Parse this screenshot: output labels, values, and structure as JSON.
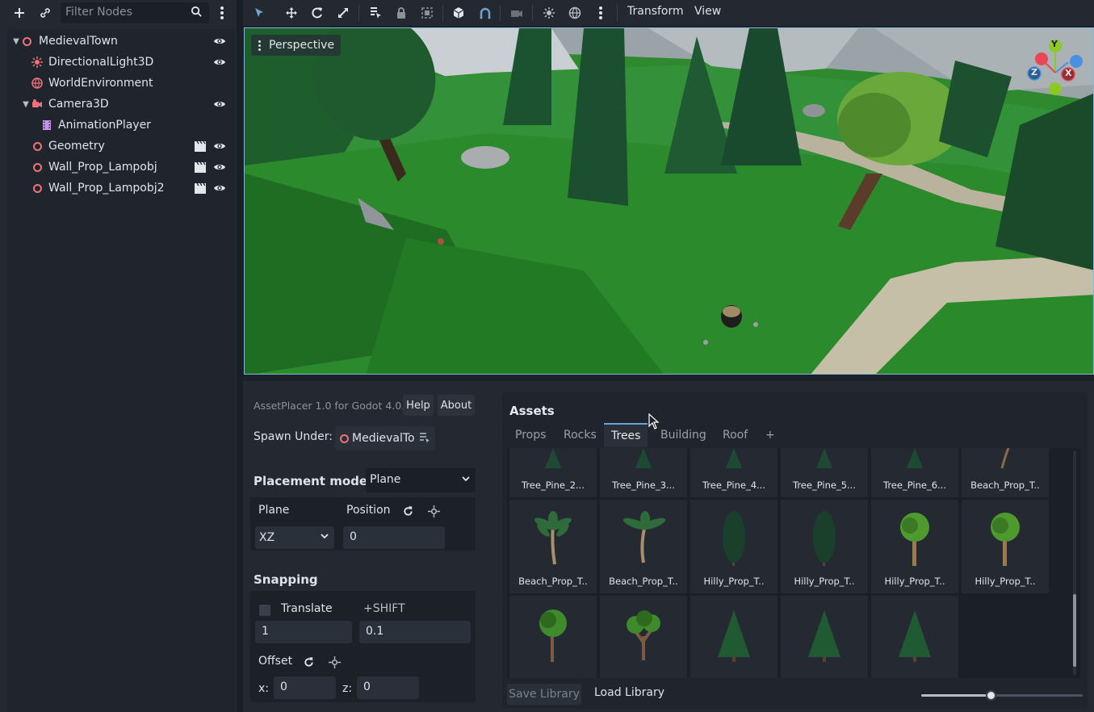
{
  "scene_dock": {
    "filter_placeholder": "Filter Nodes",
    "nodes": [
      {
        "label": "MedievalTown",
        "icon": "node3d-ring-icon",
        "depth": 0,
        "arrow": true,
        "visible": true,
        "scene": false
      },
      {
        "label": "DirectionalLight3D",
        "icon": "sun-light-icon",
        "depth": 1,
        "arrow": false,
        "visible": true,
        "scene": false
      },
      {
        "label": "WorldEnvironment",
        "icon": "globe-icon",
        "depth": 1,
        "arrow": false,
        "visible": false,
        "scene": false
      },
      {
        "label": "Camera3D",
        "icon": "camera-icon",
        "depth": 1,
        "arrow": true,
        "visible": true,
        "scene": false
      },
      {
        "label": "AnimationPlayer",
        "icon": "film-icon",
        "depth": 2,
        "arrow": false,
        "visible": false,
        "scene": false
      },
      {
        "label": "Geometry",
        "icon": "node3d-ring-icon",
        "depth": 1,
        "arrow": false,
        "visible": true,
        "scene": true
      },
      {
        "label": "Wall_Prop_Lampobj",
        "icon": "node3d-ring-icon",
        "depth": 1,
        "arrow": false,
        "visible": true,
        "scene": true
      },
      {
        "label": "Wall_Prop_Lampobj2",
        "icon": "node3d-ring-icon",
        "depth": 1,
        "arrow": false,
        "visible": true,
        "scene": true
      }
    ]
  },
  "toolbar": {
    "transform_label": "Transform",
    "view_label": "View"
  },
  "viewport": {
    "perspective_label": "Perspective",
    "gizmo": {
      "y": "Y",
      "z": "Z",
      "x": "X"
    }
  },
  "asset_placer": {
    "title": "AssetPlacer 1.0 for Godot 4.0.",
    "help_label": "Help",
    "about_label": "About",
    "spawn_under_label": "Spawn Under:",
    "spawn_under_value": "MedievalTo",
    "placement_mode_label": "Placement mode:",
    "placement_mode_value": "Plane",
    "plane_label": "Plane",
    "position_label": "Position",
    "plane_value": "XZ",
    "position_value": "0",
    "snapping_label": "Snapping",
    "translate_label": "Translate",
    "shift_label": "+SHIFT",
    "snap_value": "1",
    "snap_shift_value": "0.1",
    "offset_label": "Offset",
    "x_label": "x:",
    "x_value": "0",
    "z_label": "z:",
    "z_value": "0"
  },
  "assets": {
    "title": "Assets",
    "tabs": [
      "Props",
      "Rocks",
      "Trees",
      "Building",
      "Roof",
      "+"
    ],
    "active_tab": "Trees",
    "row1": [
      "Tree_Pine_2...",
      "Tree_Pine_3...",
      "Tree_Pine_4...",
      "Tree_Pine_5...",
      "Tree_Pine_6...",
      "Beach_Prop_T.."
    ],
    "row2": [
      "Beach_Prop_T..",
      "Beach_Prop_T..",
      "Hilly_Prop_T..",
      "Hilly_Prop_T..",
      "Hilly_Prop_T..",
      "Hilly_Prop_T.."
    ],
    "save_library_label": "Save Library",
    "load_library_label": "Load Library",
    "zoom_fraction": 0.43
  },
  "colors": {
    "accent": "#6ea2d0",
    "node_ring": "#f07178",
    "grass": "#2c7a2c"
  }
}
